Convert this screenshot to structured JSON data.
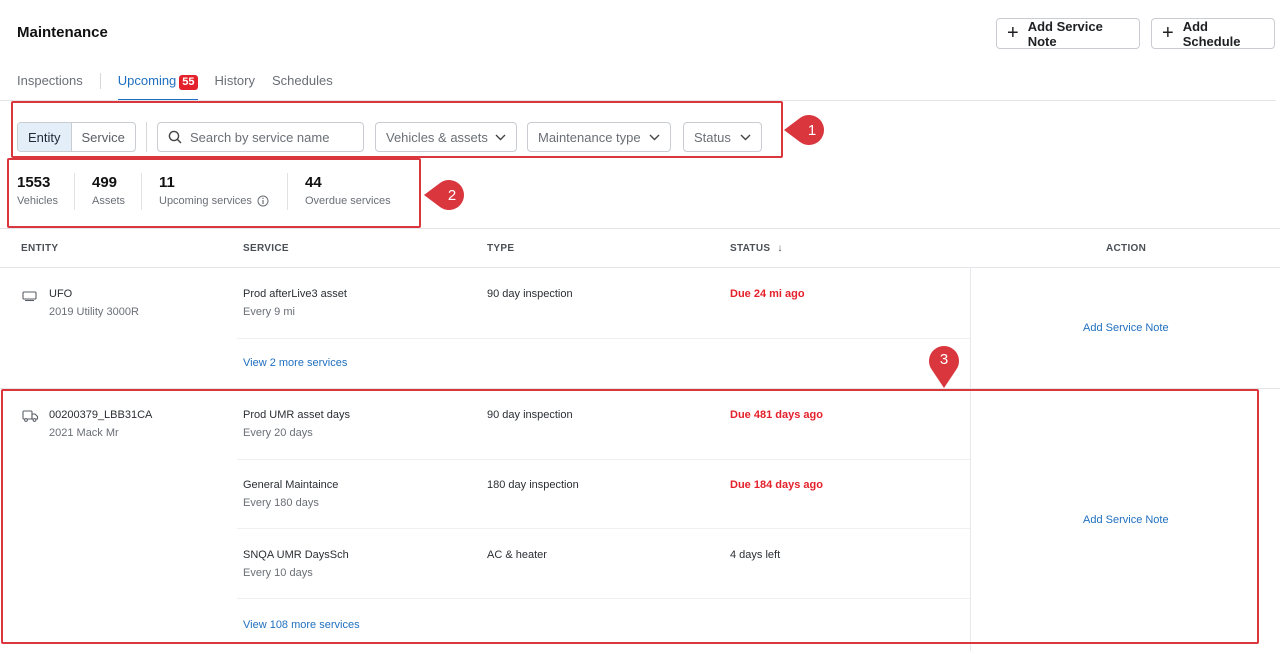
{
  "header": {
    "title": "Maintenance",
    "add_service_note": "Add Service Note",
    "add_schedule": "Add Schedule"
  },
  "tabs": [
    {
      "label": "Inspections"
    },
    {
      "label": "Upcoming",
      "badge": "55"
    },
    {
      "label": "History"
    },
    {
      "label": "Schedules"
    }
  ],
  "filters": {
    "segment": [
      "Entity",
      "Service"
    ],
    "search_placeholder": "Search by service name",
    "vehicles": "Vehicles & assets",
    "maintenance_type": "Maintenance type",
    "status": "Status"
  },
  "stats": [
    {
      "value": "1553",
      "label": "Vehicles"
    },
    {
      "value": "499",
      "label": "Assets"
    },
    {
      "value": "11",
      "label": "Upcoming services"
    },
    {
      "value": "44",
      "label": "Overdue services"
    }
  ],
  "table": {
    "headers": {
      "entity": "ENTITY",
      "service": "SERVICE",
      "type": "TYPE",
      "status": "STATUS",
      "status_arrow": "↓",
      "action": "ACTION"
    },
    "rows": [
      {
        "entity_name": "UFO",
        "entity_sub": "2019 Utility 3000R",
        "services": [
          {
            "name": "Prod afterLive3 asset",
            "every": "Every 9 mi",
            "type": "90 day inspection",
            "status": "Due 24 mi ago"
          }
        ],
        "more": "View 2 more services",
        "action": "Add Service Note"
      },
      {
        "entity_name": "00200379_LBB31CA",
        "entity_sub": "2021 Mack Mr",
        "services": [
          {
            "name": "Prod UMR asset days",
            "every": "Every 20 days",
            "type": "90 day inspection",
            "status": "Due 481 days ago"
          },
          {
            "name": "General Maintaince",
            "every": "Every 180 days",
            "type": "180 day inspection",
            "status": "Due 184 days ago"
          },
          {
            "name": "SNQA UMR DaysSch",
            "every": "Every 10 days",
            "type": "AC & heater",
            "status": "4 days left"
          }
        ],
        "more": "View 108 more services",
        "action": "Add Service Note"
      }
    ]
  },
  "annotations": [
    "1",
    "2",
    "3"
  ],
  "colors": {
    "accent": "#1f6fbf",
    "danger": "#e4202a",
    "annotation": "#d9363e"
  }
}
